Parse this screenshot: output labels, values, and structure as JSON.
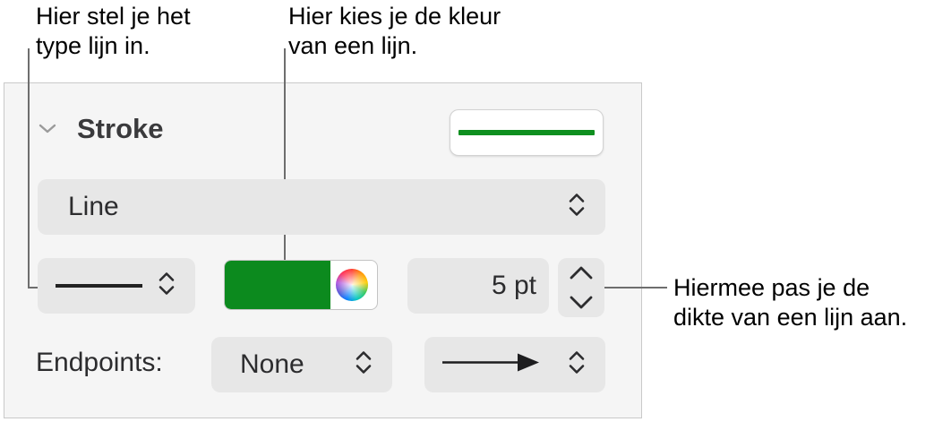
{
  "callouts": {
    "line_type": [
      "Hier stel je het",
      "type lijn in."
    ],
    "line_color": [
      "Hier kies je de kleur",
      "van een lijn."
    ],
    "line_width": [
      "Hiermee pas je de",
      "dikte van een lijn aan."
    ]
  },
  "stroke": {
    "title": "Stroke",
    "disclosure_icon": "chevron-down-icon",
    "preview_color": "#0f8f1f",
    "type_select": {
      "value": "Line",
      "icon": "updown-chevron-icon"
    },
    "line_style": {
      "value": "solid",
      "icon": "updown-chevron-icon"
    },
    "color": {
      "value": "#0c8a1e",
      "picker_icon": "color-wheel-icon"
    },
    "width": {
      "value": "5 pt",
      "up_icon": "chevron-up-icon",
      "down_icon": "chevron-down-icon"
    },
    "endpoints": {
      "label": "Endpoints:",
      "start_value": "None",
      "end_value": "arrow",
      "end_icon": "arrow-right-icon"
    }
  }
}
